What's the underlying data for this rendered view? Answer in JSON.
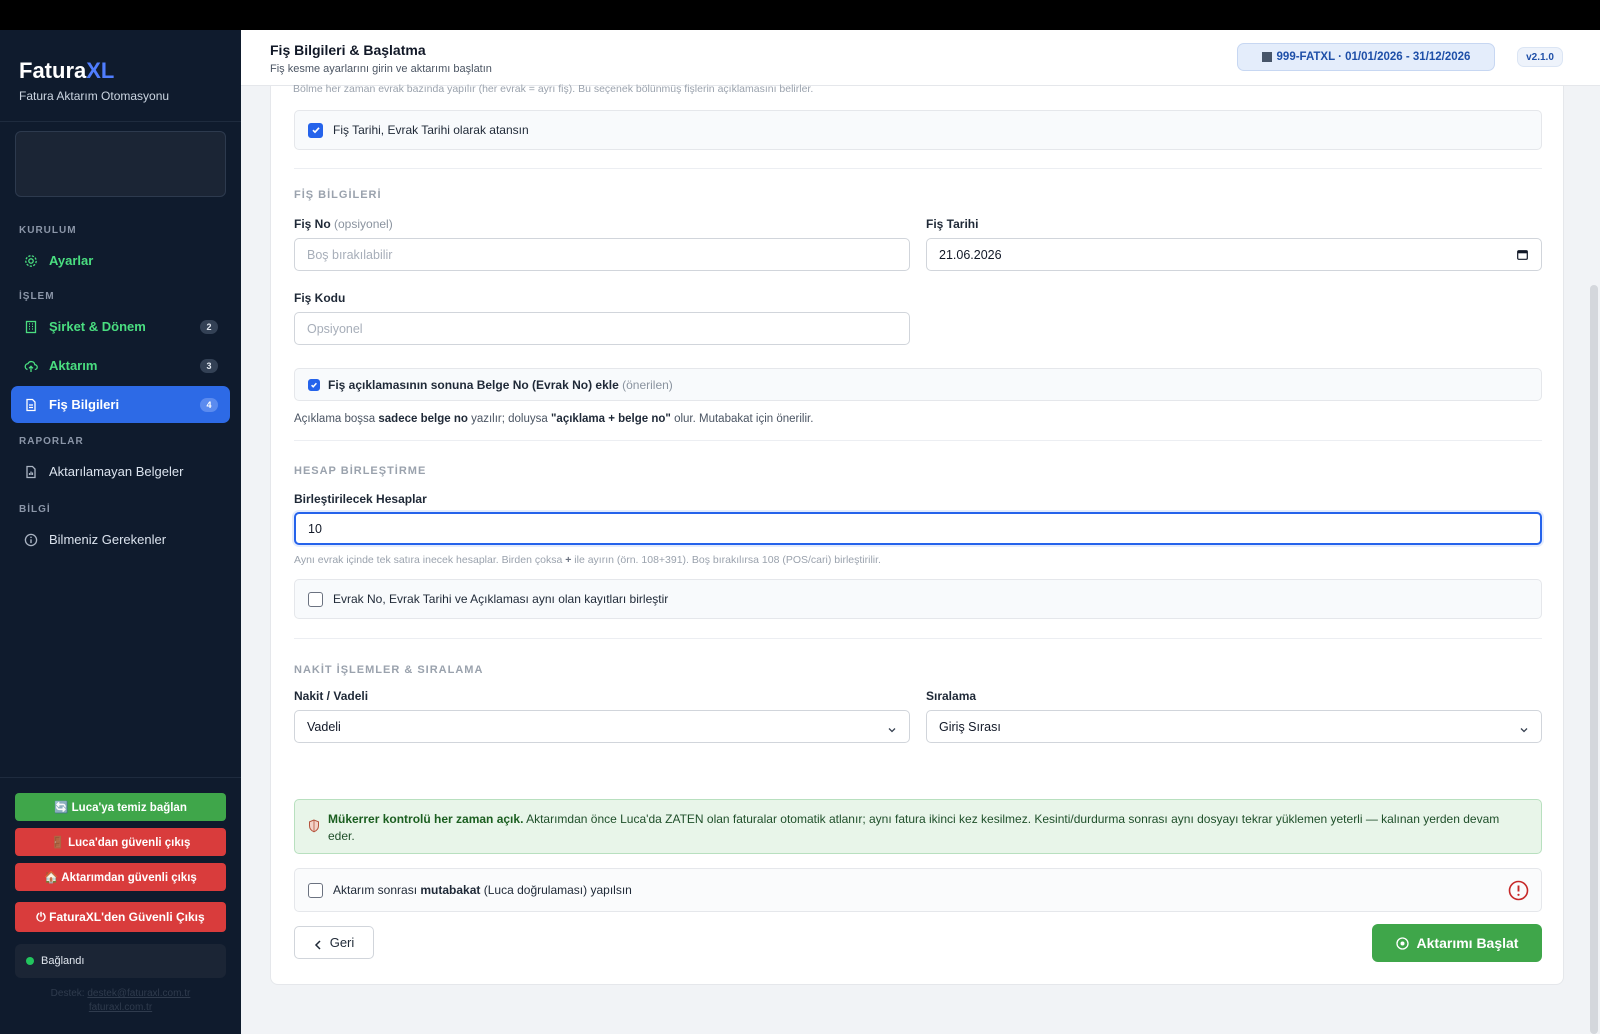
{
  "app": {
    "brand_main": "Fatura",
    "brand_accent": "XL",
    "brand_sub": "Fatura Aktarım Otomasyonu"
  },
  "sidebar": {
    "sections": {
      "kurulum": "KURULUM",
      "islem": "İŞLEM",
      "raporlar": "RAPORLAR",
      "bilgi": "BİLGİ"
    },
    "items": [
      {
        "label": "Ayarlar",
        "icon": "gear-icon"
      },
      {
        "label": "Şirket & Dönem",
        "badge": "2",
        "icon": "building-icon"
      },
      {
        "label": "Aktarım",
        "badge": "3",
        "icon": "upload-cloud-icon"
      },
      {
        "label": "Fiş Bilgileri",
        "badge": "4",
        "icon": "document-icon",
        "active": true
      },
      {
        "label": "Aktarılamayan Belgeler",
        "icon": "report-icon"
      },
      {
        "label": "Bilmeniz Gerekenler",
        "icon": "info-icon"
      }
    ],
    "buttons": {
      "luca_connect": "🔄 Luca'ya temiz bağlan",
      "luca_exit": "🚪 Luca'dan güvenli çıkış",
      "transfer_exit": "🏠 Aktarımdan güvenli çıkış",
      "app_exit": "⏻ FaturaXL'den Güvenli Çıkış"
    },
    "status": "Bağlandı",
    "contact_prefix": "Destek:",
    "contact_email": "destek@faturaxl.com.tr",
    "contact_site": "faturaxl.com.tr"
  },
  "header": {
    "title": "Fiş Bilgileri & Başlatma",
    "subtitle": "Fiş kesme ayarlarını girin ve aktarımı başlatın",
    "company_chip": "999-FATXL  ·  01/01/2026 - 31/12/2026",
    "version": "v2.1.0"
  },
  "form": {
    "top_note": "Bölme her zaman evrak bazında yapılır (her evrak = ayrı fiş). Bu seçenek bölünmüş fişlerin açıklamasını belirler.",
    "date_assign_label": "Fiş Tarihi, Evrak Tarihi olarak atansın",
    "date_assign_checked": true,
    "fis_section": "FİŞ BİLGİLERİ",
    "fis_no_label": "Fiş No",
    "fis_no_optional": "(opsiyonel)",
    "fis_no_placeholder": "Boş bırakılabilir",
    "fis_no_value": "",
    "fis_tarihi_label": "Fiş Tarihi",
    "fis_tarihi_value": "21.06.2026",
    "fis_kodu_label": "Fiş Kodu",
    "fis_kodu_placeholder": "Opsiyonel",
    "belge_no_label_pre": "Fiş açıklamasının sonuna Belge No (Evrak No) ekle",
    "belge_no_label_suffix": "(önerilen)",
    "belge_no_checked": true,
    "belge_help_1": "Açıklama boşsa",
    "belge_help_b1": "sadece belge no",
    "belge_help_2": "yazılır; doluysa",
    "belge_help_b2": "\"açıklama + belge no\"",
    "belge_help_3": "olur. Mutabakat için önerilir.",
    "hesap_section": "HESAP BİRLEŞTİRME",
    "birlestir_label": "Birleştirilecek Hesaplar",
    "birlestir_value": "10",
    "birlestir_help_1": "Aynı evrak içinde tek satıra inecek hesaplar. Birden çoksa",
    "birlestir_help_b": "+",
    "birlestir_help_2": "ile ayırın (örn. 108+391). Boş bırakılırsa 108 (POS/cari) birleştirilir.",
    "merge_same_label": "Evrak No, Evrak Tarihi ve Açıklaması aynı olan kayıtları birleştir",
    "merge_same_checked": false,
    "nakit_section": "NAKİT İŞLEMLER & SIRALAMA",
    "nakit_label": "Nakit / Vadeli",
    "nakit_value": "Vadeli",
    "siralama_label": "Sıralama",
    "siralama_value": "Giriş Sırası",
    "info_bold": "Mükerrer kontrolü her zaman açık.",
    "info_text": "Aktarımdan önce Luca'da ZATEN olan faturalar otomatik atlanır; aynı fatura ikinci kez kesilmez. Kesinti/durdurma sonrası aynı dosyayı tekrar yüklemen yeterli — kalınan yerden devam eder.",
    "muta_pre": "Aktarım sonrası",
    "muta_bold": "mutabakat",
    "muta_post": "(Luca doğrulaması) yapılsın",
    "muta_checked": false,
    "back_button": "Geri",
    "start_button": "Aktarımı Başlat"
  },
  "colors": {
    "sidebar_bg": "#0f1b2d",
    "accent_blue": "#2d6ae6",
    "green": "#3fa64a",
    "red": "#d93c3c"
  }
}
